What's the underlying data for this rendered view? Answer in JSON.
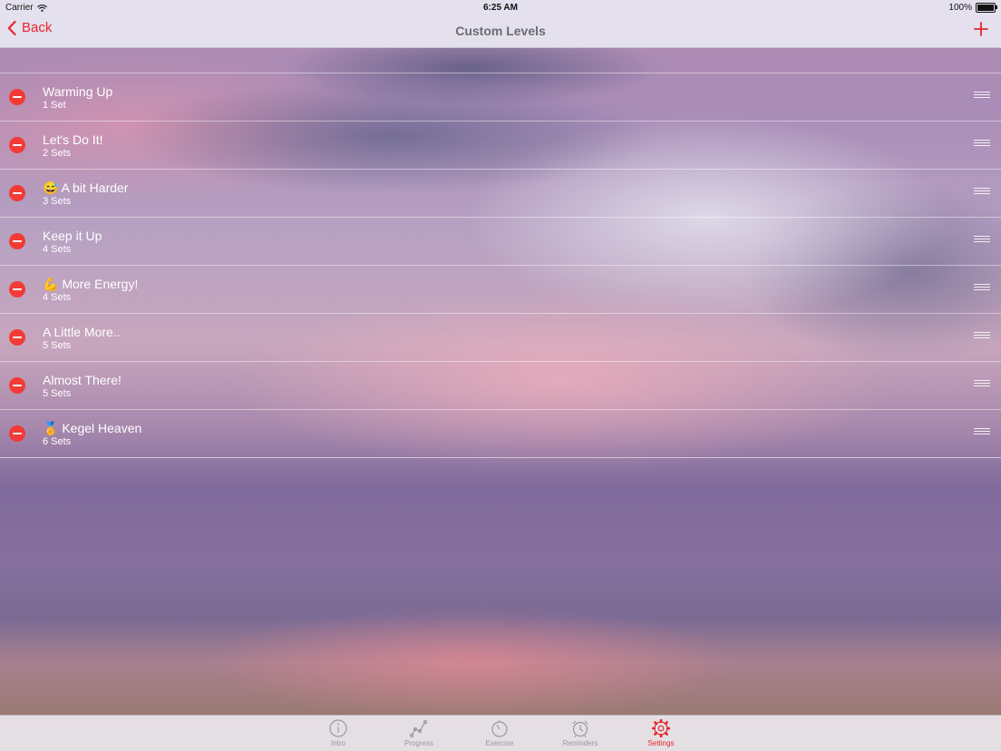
{
  "status_bar": {
    "carrier": "Carrier",
    "time": "6:25 AM",
    "battery": "100%"
  },
  "nav": {
    "back_label": "Back",
    "title": "Custom Levels",
    "accent_color": "#e5262b"
  },
  "levels": [
    {
      "title": "Warming Up",
      "subtitle": "1 Set"
    },
    {
      "title": "Let's Do It!",
      "subtitle": "2 Sets"
    },
    {
      "title": "😅 A bit Harder",
      "subtitle": "3 Sets"
    },
    {
      "title": "Keep it Up",
      "subtitle": "4 Sets"
    },
    {
      "title": "💪 More Energy!",
      "subtitle": "4 Sets"
    },
    {
      "title": "A Little More..",
      "subtitle": "5 Sets"
    },
    {
      "title": "Almost There!",
      "subtitle": "5 Sets"
    },
    {
      "title": "🏅 Kegel Heaven",
      "subtitle": "6 Sets"
    }
  ],
  "tabs": [
    {
      "label": "Intro",
      "icon": "info-icon",
      "active": false
    },
    {
      "label": "Progress",
      "icon": "progress-graph-icon",
      "active": false
    },
    {
      "label": "Exercise",
      "icon": "stopwatch-icon",
      "active": false
    },
    {
      "label": "Reminders",
      "icon": "alarm-clock-icon",
      "active": false
    },
    {
      "label": "Settings",
      "icon": "gear-icon",
      "active": true
    }
  ]
}
